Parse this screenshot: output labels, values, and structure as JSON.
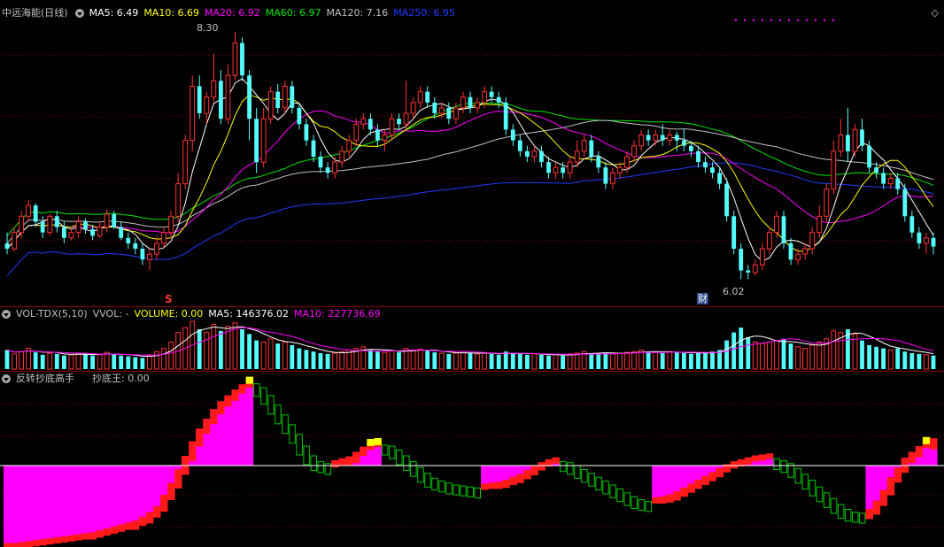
{
  "colors": {
    "up": "#ff3232",
    "down": "#54fcfc",
    "ma5": "#ffffff",
    "ma10": "#ffff00",
    "ma20": "#ff00ff",
    "ma60": "#00e600",
    "ma120": "#c0c0c0",
    "ma250": "#1e3cff",
    "vol": "#c0c0c0",
    "vola5": "#ffffff",
    "vola10": "#ff00ff"
  },
  "price_panel": {
    "title": "中远海能(日线)",
    "ma5": "MA5: 6.49",
    "ma10": "MA10: 6.69",
    "ma20": "MA20: 6.92",
    "ma60": "MA60: 6.97",
    "ma120": "MA120: 7.16",
    "ma250": "MA250: 6.95",
    "high_label": "8.30",
    "low_label": "6.02",
    "signal_mark": "S",
    "finance_mark": "财"
  },
  "volume_panel": {
    "title": "VOL-TDX(5,10)",
    "vvol": "VVOL: -",
    "volume": "VOLUME: 0.00",
    "ma5": "MA5: 146376.02",
    "ma10": "MA10: 227736.69"
  },
  "indicator_panel": {
    "title": "反转抄底高手",
    "value": "抄底王: 0.00"
  },
  "chart_data": {
    "type": "candlestick",
    "ylim": [
      5.9,
      8.4
    ],
    "candles": [
      [
        6.35,
        6.3,
        6.45,
        6.25
      ],
      [
        6.3,
        6.45,
        6.5,
        6.28
      ],
      [
        6.45,
        6.6,
        6.65,
        6.4
      ],
      [
        6.6,
        6.7,
        6.75,
        6.55
      ],
      [
        6.7,
        6.55,
        6.72,
        6.5
      ],
      [
        6.55,
        6.45,
        6.6,
        6.4
      ],
      [
        6.45,
        6.6,
        6.62,
        6.42
      ],
      [
        6.6,
        6.5,
        6.65,
        6.45
      ],
      [
        6.5,
        6.4,
        6.55,
        6.35
      ],
      [
        6.4,
        6.45,
        6.5,
        6.38
      ],
      [
        6.45,
        6.55,
        6.6,
        6.4
      ],
      [
        6.55,
        6.48,
        6.58,
        6.44
      ],
      [
        6.48,
        6.42,
        6.52,
        6.38
      ],
      [
        6.42,
        6.5,
        6.55,
        6.4
      ],
      [
        6.5,
        6.62,
        6.66,
        6.45
      ],
      [
        6.62,
        6.5,
        6.65,
        6.48
      ],
      [
        6.5,
        6.4,
        6.55,
        6.38
      ],
      [
        6.4,
        6.35,
        6.45,
        6.3
      ],
      [
        6.35,
        6.3,
        6.4,
        6.25
      ],
      [
        6.3,
        6.2,
        6.35,
        6.15
      ],
      [
        6.2,
        6.25,
        6.3,
        6.1
      ],
      [
        6.25,
        6.35,
        6.42,
        6.2
      ],
      [
        6.35,
        6.45,
        6.5,
        6.3
      ],
      [
        6.45,
        6.6,
        6.65,
        6.4
      ],
      [
        6.6,
        6.9,
        7.0,
        6.55
      ],
      [
        6.9,
        7.3,
        7.35,
        6.85
      ],
      [
        7.3,
        7.8,
        7.9,
        7.2
      ],
      [
        7.8,
        7.55,
        7.9,
        7.5
      ],
      [
        7.55,
        7.7,
        7.75,
        7.45
      ],
      [
        7.7,
        7.85,
        8.1,
        7.65
      ],
      [
        7.85,
        7.5,
        7.95,
        7.45
      ],
      [
        7.5,
        7.9,
        8.0,
        7.45
      ],
      [
        7.9,
        8.2,
        8.3,
        7.85
      ],
      [
        8.2,
        7.9,
        8.25,
        7.85
      ],
      [
        7.9,
        7.5,
        7.95,
        7.3
      ],
      [
        7.5,
        7.1,
        7.6,
        7.0
      ],
      [
        7.1,
        7.5,
        7.6,
        7.05
      ],
      [
        7.5,
        7.75,
        7.8,
        7.45
      ],
      [
        7.75,
        7.6,
        7.82,
        7.55
      ],
      [
        7.6,
        7.8,
        7.85,
        7.55
      ],
      [
        7.8,
        7.6,
        7.85,
        7.55
      ],
      [
        7.6,
        7.45,
        7.65,
        7.4
      ],
      [
        7.45,
        7.3,
        7.5,
        7.25
      ],
      [
        7.3,
        7.15,
        7.35,
        7.1
      ],
      [
        7.15,
        7.05,
        7.2,
        7.0
      ],
      [
        7.05,
        7.0,
        7.1,
        6.95
      ],
      [
        7.0,
        7.1,
        7.15,
        6.95
      ],
      [
        7.1,
        7.2,
        7.25,
        7.05
      ],
      [
        7.2,
        7.3,
        7.35,
        7.15
      ],
      [
        7.3,
        7.45,
        7.5,
        7.25
      ],
      [
        7.45,
        7.5,
        7.55,
        7.4
      ],
      [
        7.5,
        7.4,
        7.55,
        7.35
      ],
      [
        7.4,
        7.3,
        7.45,
        7.25
      ],
      [
        7.3,
        7.35,
        7.4,
        7.2
      ],
      [
        7.35,
        7.5,
        7.55,
        7.3
      ],
      [
        7.5,
        7.45,
        7.55,
        7.4
      ],
      [
        7.45,
        7.55,
        7.85,
        7.4
      ],
      [
        7.55,
        7.65,
        7.7,
        7.5
      ],
      [
        7.65,
        7.75,
        7.8,
        7.6
      ],
      [
        7.75,
        7.65,
        7.8,
        7.6
      ],
      [
        7.65,
        7.55,
        7.7,
        7.5
      ],
      [
        7.55,
        7.6,
        7.65,
        7.5
      ],
      [
        7.6,
        7.5,
        7.65,
        7.45
      ],
      [
        7.5,
        7.6,
        7.65,
        7.45
      ],
      [
        7.6,
        7.7,
        7.75,
        7.55
      ],
      [
        7.7,
        7.6,
        7.75,
        7.55
      ],
      [
        7.6,
        7.65,
        7.7,
        7.55
      ],
      [
        7.65,
        7.75,
        7.8,
        7.6
      ],
      [
        7.75,
        7.7,
        7.8,
        7.65
      ],
      [
        7.7,
        7.65,
        7.75,
        7.6
      ],
      [
        7.65,
        7.4,
        7.7,
        7.35
      ],
      [
        7.4,
        7.3,
        7.45,
        7.25
      ],
      [
        7.3,
        7.2,
        7.35,
        7.15
      ],
      [
        7.2,
        7.15,
        7.25,
        7.1
      ],
      [
        7.15,
        7.2,
        7.25,
        7.1
      ],
      [
        7.2,
        7.1,
        7.25,
        7.05
      ],
      [
        7.1,
        7.0,
        7.15,
        6.95
      ],
      [
        7.0,
        7.05,
        7.1,
        6.95
      ],
      [
        7.05,
        7.0,
        7.1,
        6.95
      ],
      [
        7.0,
        7.1,
        7.15,
        6.95
      ],
      [
        7.1,
        7.2,
        7.3,
        7.05
      ],
      [
        7.2,
        7.3,
        7.35,
        7.15
      ],
      [
        7.3,
        7.15,
        7.35,
        7.1
      ],
      [
        7.15,
        7.05,
        7.2,
        7.0
      ],
      [
        7.05,
        6.9,
        7.1,
        6.85
      ],
      [
        6.9,
        7.0,
        7.05,
        6.85
      ],
      [
        7.0,
        7.05,
        7.1,
        6.95
      ],
      [
        7.05,
        7.15,
        7.2,
        7.0
      ],
      [
        7.15,
        7.25,
        7.3,
        7.1
      ],
      [
        7.25,
        7.35,
        7.4,
        7.2
      ],
      [
        7.35,
        7.3,
        7.4,
        7.25
      ],
      [
        7.3,
        7.35,
        7.4,
        7.25
      ],
      [
        7.35,
        7.3,
        7.45,
        7.25
      ],
      [
        7.3,
        7.35,
        7.4,
        7.25
      ],
      [
        7.35,
        7.3,
        7.38,
        7.2
      ],
      [
        7.3,
        7.25,
        7.4,
        7.2
      ],
      [
        7.25,
        7.2,
        7.3,
        7.15
      ],
      [
        7.2,
        7.1,
        7.25,
        7.05
      ],
      [
        7.1,
        7.05,
        7.15,
        7.0
      ],
      [
        7.05,
        7.0,
        7.1,
        6.95
      ],
      [
        7.0,
        6.9,
        7.05,
        6.85
      ],
      [
        6.9,
        6.6,
        6.95,
        6.55
      ],
      [
        6.6,
        6.3,
        6.65,
        6.25
      ],
      [
        6.3,
        6.1,
        6.35,
        6.02
      ],
      [
        6.1,
        6.08,
        6.15,
        6.02
      ],
      [
        6.08,
        6.15,
        6.2,
        6.05
      ],
      [
        6.15,
        6.3,
        6.35,
        6.1
      ],
      [
        6.3,
        6.45,
        6.5,
        6.25
      ],
      [
        6.45,
        6.6,
        6.65,
        6.4
      ],
      [
        6.6,
        6.35,
        6.65,
        6.3
      ],
      [
        6.35,
        6.2,
        6.4,
        6.15
      ],
      [
        6.2,
        6.25,
        6.3,
        6.15
      ],
      [
        6.25,
        6.3,
        6.35,
        6.2
      ],
      [
        6.3,
        6.45,
        6.5,
        6.25
      ],
      [
        6.45,
        6.6,
        6.7,
        6.4
      ],
      [
        6.6,
        6.85,
        6.9,
        6.55
      ],
      [
        6.85,
        7.2,
        7.3,
        6.8
      ],
      [
        7.2,
        7.35,
        7.5,
        7.15
      ],
      [
        7.35,
        7.2,
        7.6,
        7.1
      ],
      [
        7.2,
        7.4,
        7.45,
        7.15
      ],
      [
        7.4,
        7.25,
        7.5,
        7.2
      ],
      [
        7.25,
        7.05,
        7.3,
        7.0
      ],
      [
        7.05,
        7.0,
        7.1,
        6.95
      ],
      [
        7.0,
        6.9,
        7.05,
        6.85
      ],
      [
        6.9,
        6.95,
        7.0,
        6.85
      ],
      [
        6.95,
        6.85,
        7.0,
        6.8
      ],
      [
        6.85,
        6.6,
        6.9,
        6.55
      ],
      [
        6.6,
        6.45,
        6.65,
        6.4
      ],
      [
        6.45,
        6.35,
        6.5,
        6.3
      ],
      [
        6.35,
        6.4,
        6.45,
        6.25
      ],
      [
        6.4,
        6.32,
        6.45,
        6.25
      ]
    ],
    "volume": [
      120,
      95,
      110,
      130,
      105,
      90,
      100,
      95,
      85,
      90,
      100,
      95,
      85,
      90,
      105,
      95,
      85,
      80,
      75,
      70,
      90,
      110,
      130,
      170,
      230,
      260,
      300,
      250,
      230,
      280,
      240,
      270,
      290,
      250,
      220,
      180,
      170,
      190,
      160,
      170,
      150,
      130,
      120,
      110,
      100,
      95,
      100,
      110,
      120,
      130,
      140,
      120,
      110,
      105,
      115,
      105,
      130,
      120,
      125,
      115,
      105,
      100,
      95,
      100,
      110,
      100,
      95,
      100,
      95,
      90,
      110,
      100,
      95,
      90,
      95,
      90,
      85,
      90,
      85,
      95,
      100,
      110,
      100,
      95,
      105,
      95,
      100,
      105,
      110,
      120,
      110,
      105,
      100,
      110,
      105,
      100,
      95,
      100,
      105,
      110,
      120,
      180,
      230,
      260,
      200,
      170,
      160,
      170,
      180,
      190,
      160,
      140,
      130,
      150,
      170,
      190,
      240,
      230,
      250,
      220,
      180,
      150,
      140,
      130,
      120,
      130,
      110,
      100,
      95,
      90,
      85
    ],
    "indicator": [
      -85,
      -84,
      -83,
      -82,
      -81,
      -80,
      -79,
      -78,
      -77,
      -76,
      -75,
      -74,
      -72,
      -70,
      -68,
      -66,
      -64,
      -62,
      -58,
      -54,
      -48,
      -42,
      -30,
      -18,
      -4,
      10,
      25,
      38,
      48,
      58,
      66,
      72,
      78,
      82,
      84,
      80,
      72,
      62,
      52,
      42,
      32,
      20,
      10,
      4,
      2,
      0,
      2,
      4,
      8,
      14,
      18,
      20,
      21,
      20,
      16,
      10,
      4,
      -2,
      -8,
      -13,
      -16,
      -18,
      -20,
      -21,
      -22,
      -23,
      -24,
      -23,
      -22,
      -20,
      -17,
      -14,
      -10,
      -6,
      -2,
      1,
      3,
      4,
      3,
      0,
      -4,
      -8,
      -12,
      -16,
      -20,
      -24,
      -28,
      -32,
      -35,
      -37,
      -38,
      -37,
      -35,
      -32,
      -28,
      -24,
      -20,
      -16,
      -12,
      -8,
      -4,
      -1,
      1,
      3,
      5,
      6,
      7,
      7,
      5,
      2,
      -3,
      -9,
      -15,
      -22,
      -28,
      -34,
      -40,
      -45,
      -48,
      -49,
      -50,
      -45,
      -36,
      -25,
      -12,
      -2,
      8,
      14,
      20,
      22,
      28
    ]
  }
}
